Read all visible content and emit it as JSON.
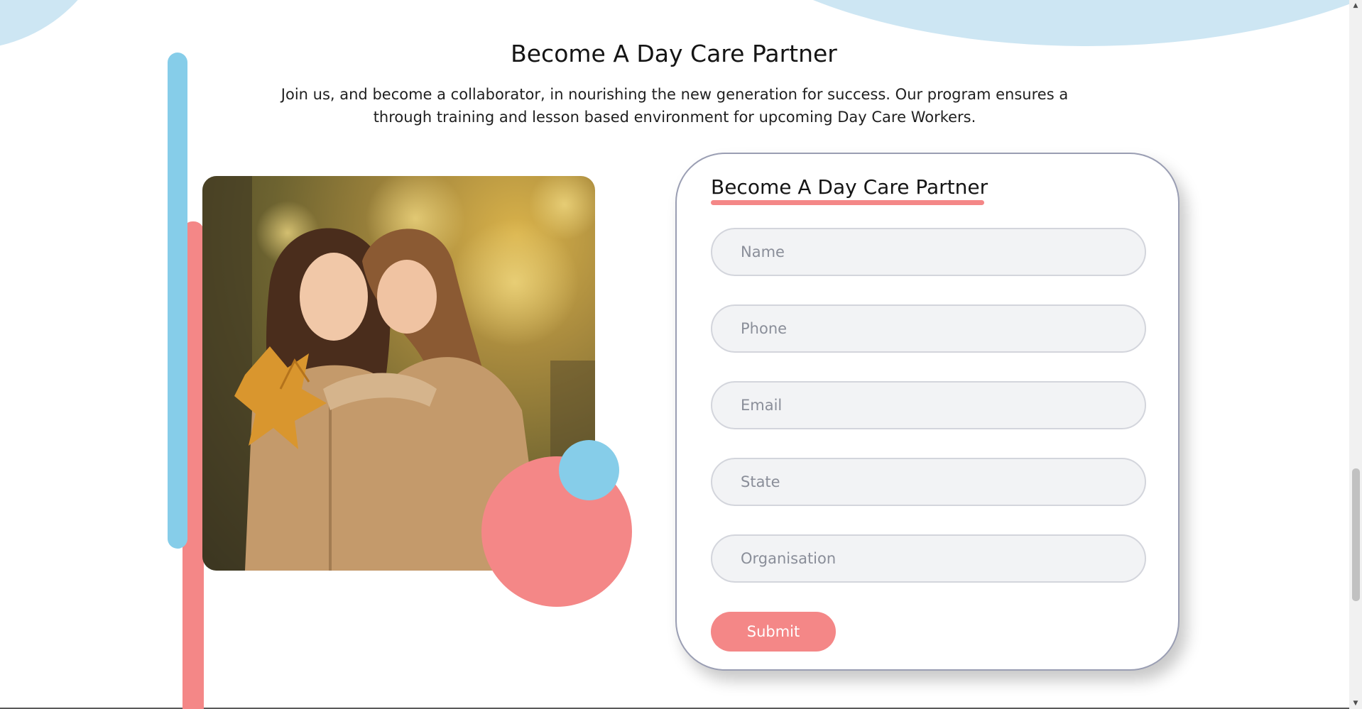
{
  "partner_section": {
    "title": "Become A Day Care Partner",
    "intro": "Join us, and become a collaborator, in nourishing the new generation for success. Our program ensures a through training and lesson based environment for upcoming Day Care Workers."
  },
  "form": {
    "title": "Become A Day Care Partner",
    "fields": {
      "name": {
        "placeholder": "Name",
        "value": ""
      },
      "phone": {
        "placeholder": "Phone",
        "value": ""
      },
      "email": {
        "placeholder": "Email",
        "value": ""
      },
      "state": {
        "placeholder": "State",
        "value": ""
      },
      "organisation": {
        "placeholder": "Organisation",
        "value": ""
      }
    },
    "submit_label": "Submit"
  },
  "colors": {
    "accent_pink": "#f48787",
    "accent_blue": "#86cde9",
    "wave_light_blue": "#cde6f3",
    "field_background": "#f2f3f5",
    "card_border": "#9a9eb3"
  },
  "icons": {
    "scroll_up": "scroll-up-arrow-icon",
    "scroll_down": "scroll-down-arrow-icon"
  }
}
